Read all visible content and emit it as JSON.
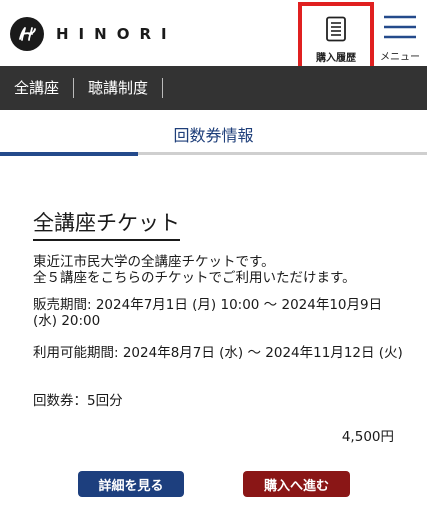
{
  "header": {
    "logo_text": "HINORI",
    "purchase_history_label": "購入履歴",
    "menu_label": "メニュー"
  },
  "nav": {
    "items": [
      "全講座",
      "聴講制度"
    ]
  },
  "tab": {
    "title": "回数券情報"
  },
  "ticket": {
    "title": "全講座チケット",
    "description_line1": "東近江市民大学の全講座チケットです。",
    "description_line2": "全５講座をこちらのチケットでご利用いただけます。",
    "sale_period": "販売期間: 2024年7月1日 (月) 10:00 〜 2024年10月9日 (水) 20:00",
    "usage_period": "利用可能期間: 2024年8月7日 (水) 〜 2024年11月12日 (火)",
    "count": "回数券：5回分",
    "price": "4,500円"
  },
  "buttons": {
    "detail_label": "詳細を見る",
    "buy_label": "購入へ進む"
  },
  "colors": {
    "nav_bg": "#333333",
    "accent_blue": "#244a8b",
    "buy_red": "#8a1616",
    "highlight_red": "#e02020"
  },
  "icons": {
    "logo": "hinori-logo-icon",
    "purchase": "document-list-icon",
    "menu": "hamburger-menu-icon"
  }
}
